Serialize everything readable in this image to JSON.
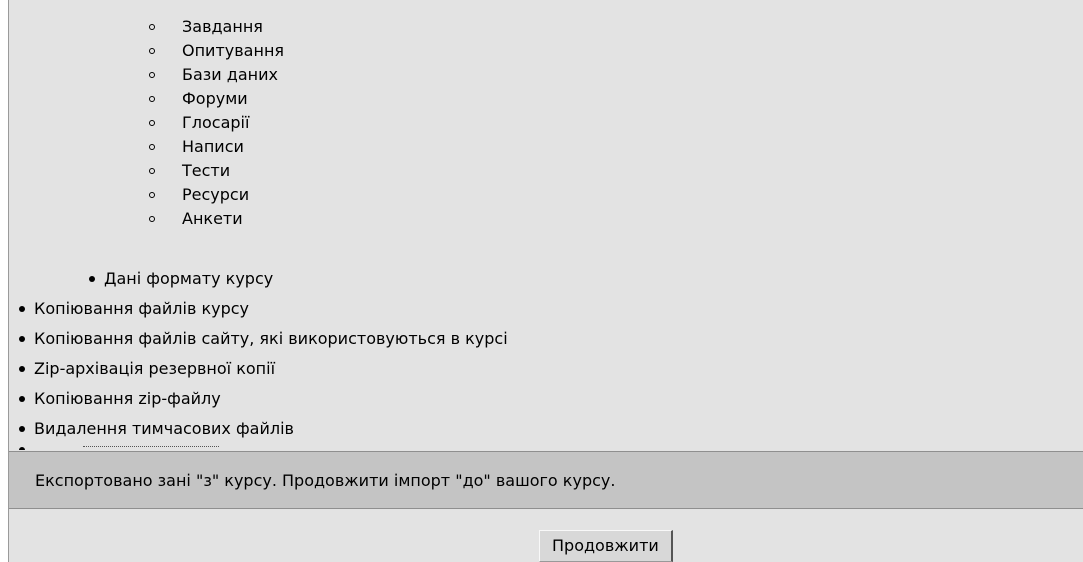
{
  "backup_steps": {
    "module_items": [
      "Завдання",
      "Опитування",
      "Бази даних",
      "Форуми",
      "Глосарії",
      "Написи",
      "Тести",
      "Ресурси",
      "Анкети"
    ],
    "course_format": "Дані формату курсу",
    "top_level": [
      "Копіювання файлів курсу",
      "Копіювання файлів сайту, які використовуються в курсі",
      "Zip-архівація резервної копії",
      "Копіювання zip-файлу",
      "Видалення тимчасових файлів"
    ]
  },
  "status": {
    "message": "Експортовано зані \"з\" курсу. Продовжити імпорт \"до\" вашого курсу."
  },
  "actions": {
    "continue_label": "Продовжити"
  }
}
